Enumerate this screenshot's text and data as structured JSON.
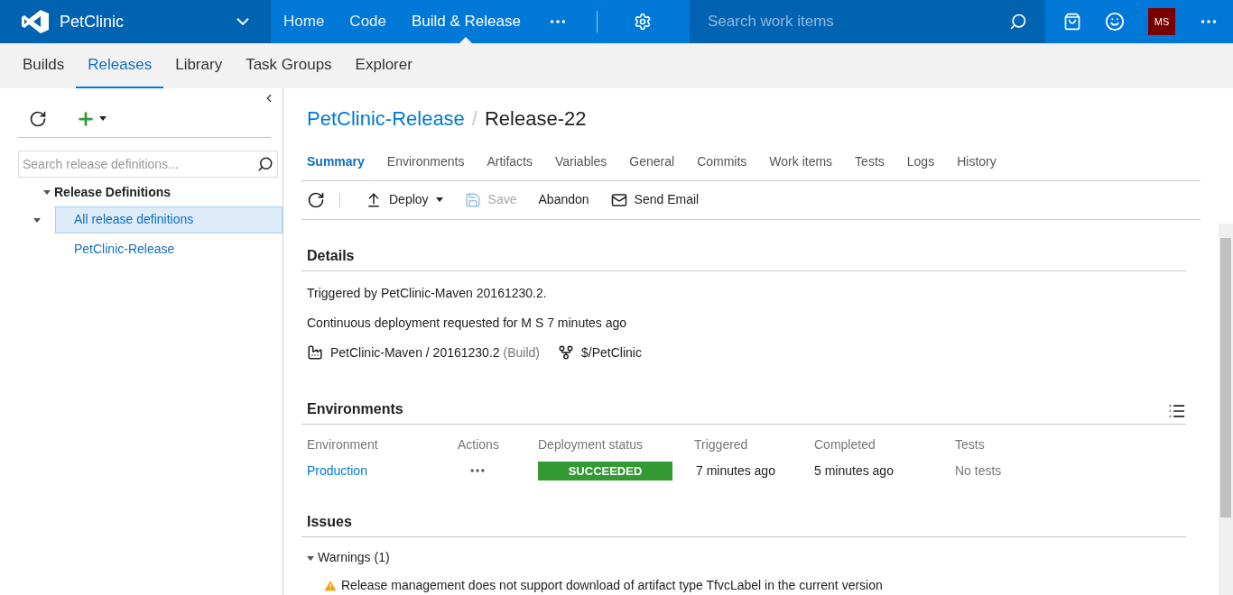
{
  "brand": {
    "name": "PetClinic"
  },
  "nav": [
    {
      "label": "Home",
      "selected": false
    },
    {
      "label": "Code",
      "selected": false
    },
    {
      "label": "Build & Release",
      "selected": true
    }
  ],
  "search": {
    "placeholder": "Search work items"
  },
  "avatar": {
    "initials": "MS"
  },
  "subnav": [
    {
      "label": "Builds",
      "selected": false
    },
    {
      "label": "Releases",
      "selected": true
    },
    {
      "label": "Library",
      "selected": false
    },
    {
      "label": "Task Groups",
      "selected": false
    },
    {
      "label": "Explorer",
      "selected": false
    }
  ],
  "sidebar": {
    "search": {
      "placeholder": "Search release definitions..."
    },
    "tree": {
      "label": "Release Definitions",
      "expanded": true,
      "children": [
        {
          "label": "All release definitions",
          "selected": true,
          "expanded": true
        },
        {
          "label": "PetClinic-Release",
          "selected": false
        }
      ]
    }
  },
  "breadcrumb": {
    "parent": "PetClinic-Release",
    "separator": "/",
    "current": "Release-22"
  },
  "tabs": [
    {
      "label": "Summary",
      "selected": true
    },
    {
      "label": "Environments",
      "selected": false
    },
    {
      "label": "Artifacts",
      "selected": false
    },
    {
      "label": "Variables",
      "selected": false
    },
    {
      "label": "General",
      "selected": false
    },
    {
      "label": "Commits",
      "selected": false
    },
    {
      "label": "Work items",
      "selected": false
    },
    {
      "label": "Tests",
      "selected": false
    },
    {
      "label": "Logs",
      "selected": false
    },
    {
      "label": "History",
      "selected": false
    }
  ],
  "toolbar": [
    {
      "kind": "deploy",
      "label": "Deploy",
      "disabled": false
    },
    {
      "kind": "save",
      "label": "Save",
      "disabled": true
    },
    {
      "kind": "abandon",
      "label": "Abandon",
      "disabled": false
    },
    {
      "kind": "email",
      "label": "Send Email",
      "disabled": false
    }
  ],
  "details": {
    "title": "Details",
    "lines": [
      "Triggered by PetClinic-Maven 20161230.2.",
      "Continuous deployment requested for M S 7 minutes ago"
    ],
    "artifact": {
      "name": "PetClinic-Maven / 20161230.2",
      "type": "(Build)",
      "source": "$/PetClinic"
    }
  },
  "environments": {
    "title": "Environments",
    "columns": [
      "Environment",
      "Actions",
      "Deployment status",
      "Triggered",
      "Completed",
      "Tests"
    ],
    "rows": [
      {
        "name": "Production",
        "status": {
          "kind": "succeeded",
          "label": "SUCCEEDED"
        },
        "triggered": "7 minutes ago",
        "completed": "5 minutes ago",
        "tests": "No tests"
      }
    ]
  },
  "issues": {
    "title": "Issues",
    "groups": [
      {
        "label": "Warnings (1)",
        "expanded": true,
        "items": [
          "Release management does not support download of artifact type TfvcLabel in the current version"
        ]
      }
    ]
  }
}
